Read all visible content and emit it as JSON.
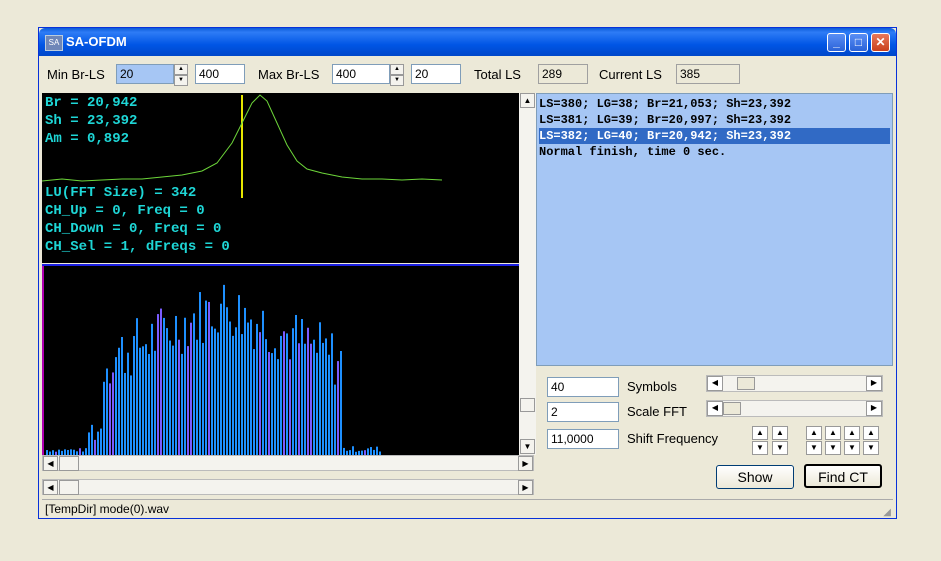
{
  "window": {
    "title": "SA-OFDM",
    "icon_text": "SA"
  },
  "toolbar": {
    "min_br_label": "Min Br-LS",
    "min_br_value": "20",
    "min_br_value2": "400",
    "max_br_label": "Max Br-LS",
    "max_br_value": "400",
    "max_br_value2": "20",
    "total_label": "Total LS",
    "total_value": "289",
    "current_label": "Current LS",
    "current_value": "385"
  },
  "scope": {
    "lines_top": [
      "Br = 20,942",
      "Sh = 23,392",
      "Am = 0,892"
    ],
    "lines_bottom": [
      "LU(FFT Size) = 342",
      "CH_Up = 0, Freq = 0",
      "CH_Down = 0, Freq = 0",
      "CH_Sel = 1, dFreqs = 0"
    ]
  },
  "log": {
    "lines": [
      "LS=380; LG=38; Br=21,053; Sh=23,392",
      "LS=381; LG=39; Br=20,997; Sh=23,392",
      "LS=382; LG=40; Br=20,942; Sh=23,392",
      "Normal finish, time 0 sec."
    ],
    "selected_index": 2
  },
  "controls": {
    "symbols_value": "40",
    "symbols_label": "Symbols",
    "scale_value": "2",
    "scale_label": "Scale FFT",
    "shift_value": "11,0000",
    "shift_label": "Shift Frequency",
    "show_label": "Show",
    "find_label": "Find CT"
  },
  "status": {
    "text": "[TempDir] mode(0).wav"
  },
  "colors": {
    "scope_text": "#1ed6d6",
    "bar_blue": "#1e90ff",
    "log_bg": "#a6c6f4",
    "selected": "#316ac5"
  }
}
